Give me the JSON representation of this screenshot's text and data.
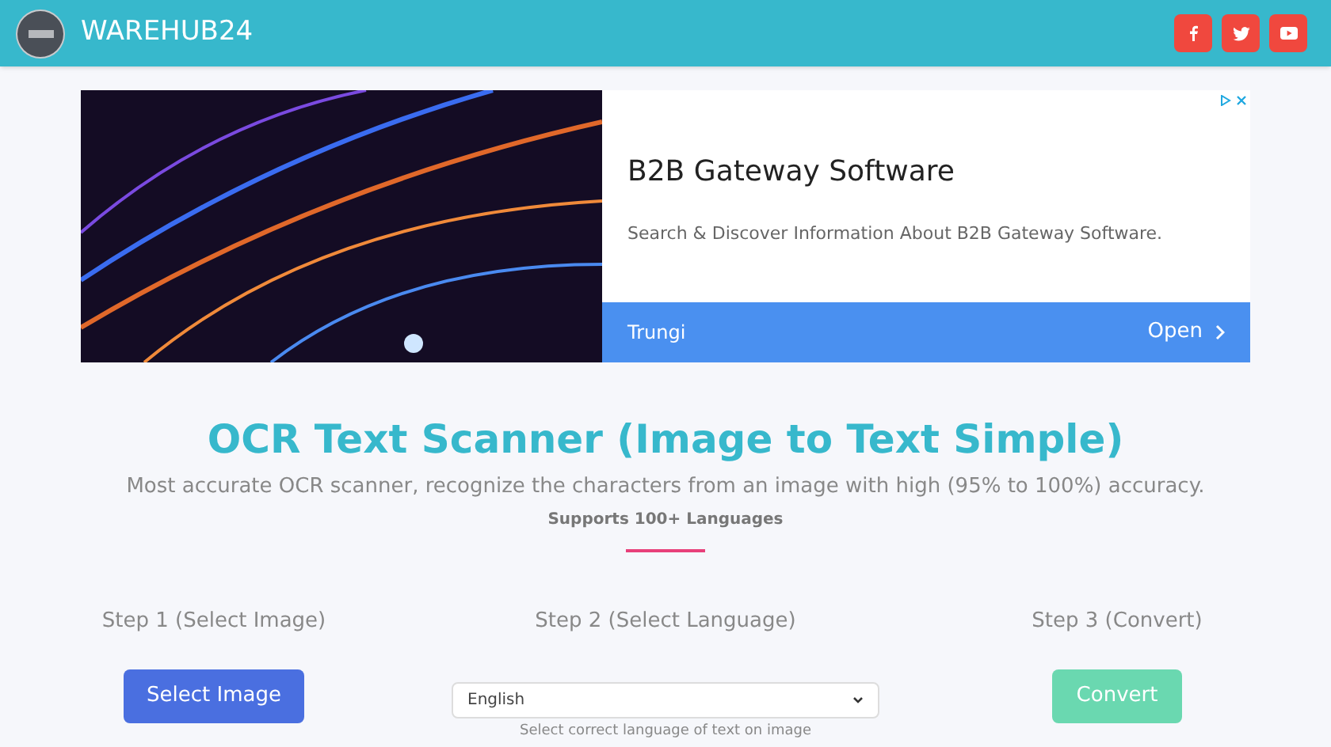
{
  "header": {
    "brand": "WAREHUB24",
    "social": [
      {
        "kind": "facebook"
      },
      {
        "kind": "twitter"
      },
      {
        "kind": "youtube"
      }
    ]
  },
  "ad": {
    "headline": "B2B Gateway Software",
    "description": "Search & Discover Information About B2B Gateway Software.",
    "advertiser": "Trungi",
    "cta": "Open"
  },
  "hero": {
    "title": "OCR Text Scanner (Image to Text Simple)",
    "subtitle": "Most accurate OCR scanner, recognize the characters from an image with high (95% to 100%) accuracy.",
    "note": "Supports 100+ Languages"
  },
  "steps": [
    {
      "label": "Step 1 (Select Image)",
      "kind": "button",
      "text": "Select Image",
      "disabled": false
    },
    {
      "label": "Step 2 (Select Language)",
      "kind": "select",
      "value": "English",
      "hint": "Select correct language of text on image"
    },
    {
      "label": "Step 3 (Convert)",
      "kind": "button",
      "text": "Convert",
      "disabled": true
    }
  ]
}
